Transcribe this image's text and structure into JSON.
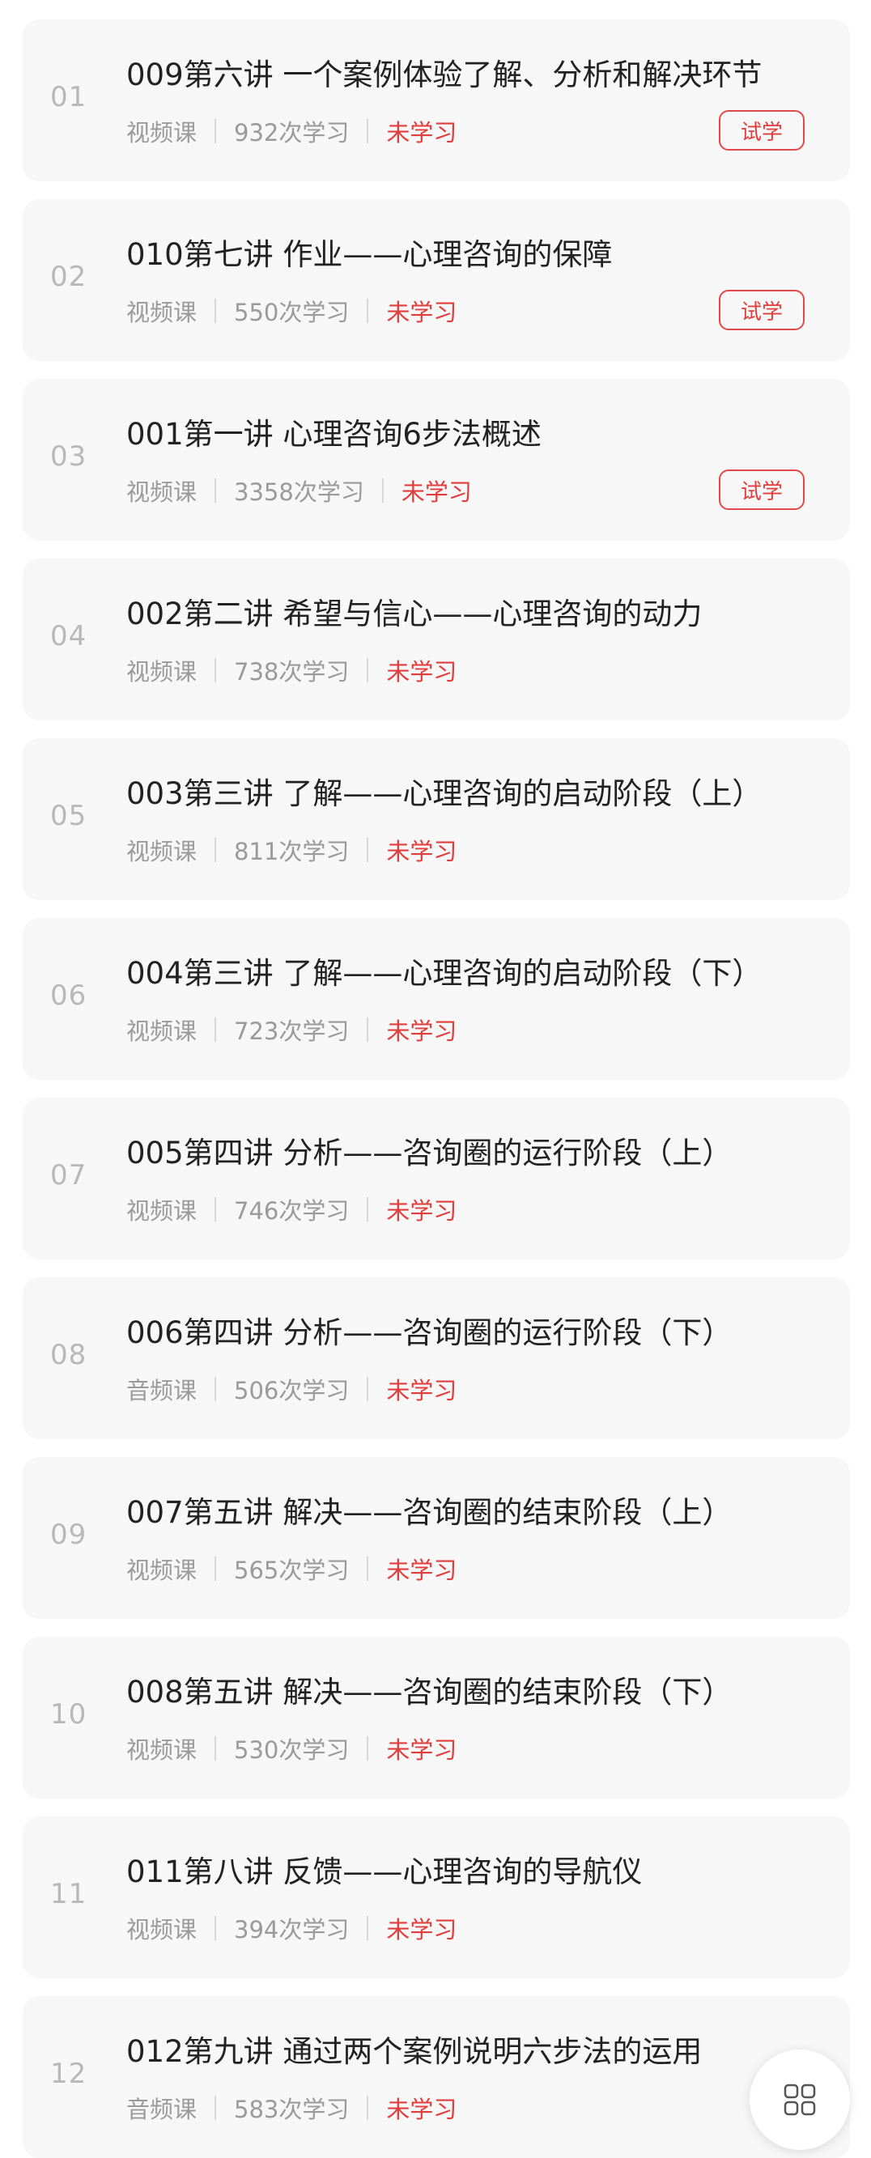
{
  "lessons": [
    {
      "num": "01",
      "title": "009第六讲 一个案例体验了解、分析和解决环节",
      "type": "视频课",
      "count": "932次学习",
      "status": "未学习",
      "trial": "试学"
    },
    {
      "num": "02",
      "title": "010第七讲 作业——心理咨询的保障",
      "type": "视频课",
      "count": "550次学习",
      "status": "未学习",
      "trial": "试学"
    },
    {
      "num": "03",
      "title": "001第一讲 心理咨询6步法概述",
      "type": "视频课",
      "count": "3358次学习",
      "status": "未学习",
      "trial": "试学"
    },
    {
      "num": "04",
      "title": "002第二讲 希望与信心——心理咨询的动力",
      "type": "视频课",
      "count": "738次学习",
      "status": "未学习"
    },
    {
      "num": "05",
      "title": "003第三讲 了解——心理咨询的启动阶段（上）",
      "type": "视频课",
      "count": "811次学习",
      "status": "未学习"
    },
    {
      "num": "06",
      "title": "004第三讲 了解——心理咨询的启动阶段（下）",
      "type": "视频课",
      "count": "723次学习",
      "status": "未学习"
    },
    {
      "num": "07",
      "title": "005第四讲 分析——咨询圈的运行阶段（上）",
      "type": "视频课",
      "count": "746次学习",
      "status": "未学习"
    },
    {
      "num": "08",
      "title": "006第四讲 分析——咨询圈的运行阶段（下）",
      "type": "音频课",
      "count": "506次学习",
      "status": "未学习"
    },
    {
      "num": "09",
      "title": "007第五讲 解决——咨询圈的结束阶段（上）",
      "type": "视频课",
      "count": "565次学习",
      "status": "未学习"
    },
    {
      "num": "10",
      "title": "008第五讲 解决——咨询圈的结束阶段（下）",
      "type": "视频课",
      "count": "530次学习",
      "status": "未学习"
    },
    {
      "num": "11",
      "title": "011第八讲 反馈——心理咨询的导航仪",
      "type": "视频课",
      "count": "394次学习",
      "status": "未学习"
    },
    {
      "num": "12",
      "title": "012第九讲 通过两个案例说明六步法的运用",
      "type": "音频课",
      "count": "583次学习",
      "status": "未学习"
    }
  ],
  "fab": {
    "icon": "grid-icon"
  },
  "colors": {
    "accent": "#e03d3d",
    "card_bg": "#f7f7f7",
    "muted": "#9a9a9a",
    "title": "#222222"
  }
}
